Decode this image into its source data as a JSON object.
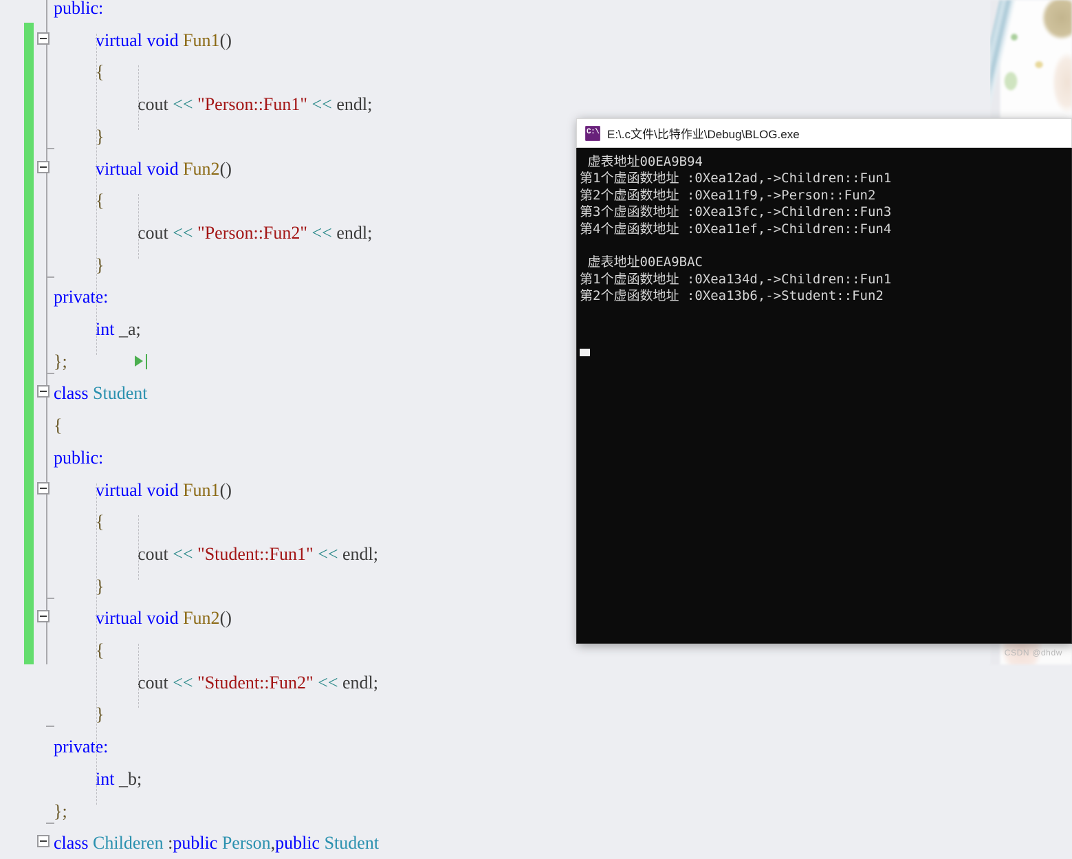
{
  "editor": {
    "language": "cpp",
    "background": "#edeef2",
    "change_bar_color": "#64dd6e",
    "colors": {
      "keyword": "#0000ff",
      "type": "#2b91af",
      "function": "#8b6914",
      "string": "#a31515",
      "operator": "#2e8b8b",
      "plain": "#3b3b3b"
    },
    "run_to_cursor_icon": "play-triangle-icon",
    "lines": [
      {
        "indent": 0,
        "tokens": [
          {
            "t": "public:",
            "c": "kw"
          }
        ]
      },
      {
        "indent": 1,
        "tokens": [
          {
            "t": "virtual void ",
            "c": "kw"
          },
          {
            "t": "Fun1",
            "c": "fn"
          },
          {
            "t": "()",
            "c": "plain"
          }
        ]
      },
      {
        "indent": 1,
        "tokens": [
          {
            "t": "{",
            "c": "brace"
          }
        ]
      },
      {
        "indent": 2,
        "tokens": [
          {
            "t": "cout ",
            "c": "plain"
          },
          {
            "t": "<<",
            "c": "op"
          },
          {
            "t": " ",
            "c": "plain"
          },
          {
            "t": "\"Person::Fun1\"",
            "c": "str"
          },
          {
            "t": " ",
            "c": "plain"
          },
          {
            "t": "<<",
            "c": "op"
          },
          {
            "t": " endl;",
            "c": "plain"
          }
        ]
      },
      {
        "indent": 1,
        "tokens": [
          {
            "t": "}",
            "c": "brace"
          }
        ]
      },
      {
        "indent": 1,
        "tokens": [
          {
            "t": "virtual void ",
            "c": "kw"
          },
          {
            "t": "Fun2",
            "c": "fn"
          },
          {
            "t": "()",
            "c": "plain"
          }
        ]
      },
      {
        "indent": 1,
        "tokens": [
          {
            "t": "{",
            "c": "brace"
          }
        ]
      },
      {
        "indent": 2,
        "tokens": [
          {
            "t": "cout ",
            "c": "plain"
          },
          {
            "t": "<<",
            "c": "op"
          },
          {
            "t": " ",
            "c": "plain"
          },
          {
            "t": "\"Person::Fun2\"",
            "c": "str"
          },
          {
            "t": " ",
            "c": "plain"
          },
          {
            "t": "<<",
            "c": "op"
          },
          {
            "t": " endl;",
            "c": "plain"
          }
        ]
      },
      {
        "indent": 1,
        "tokens": [
          {
            "t": "}",
            "c": "brace"
          }
        ]
      },
      {
        "indent": 0,
        "tokens": [
          {
            "t": "private:",
            "c": "kw"
          }
        ]
      },
      {
        "indent": 1,
        "tokens": [
          {
            "t": "int",
            "c": "kw"
          },
          {
            "t": " _a;",
            "c": "plain"
          }
        ]
      },
      {
        "indent": 0,
        "tokens": [
          {
            "t": "};",
            "c": "brace"
          }
        ]
      },
      {
        "indent": 0,
        "tokens": [
          {
            "t": "class ",
            "c": "kw"
          },
          {
            "t": "Student",
            "c": "type"
          }
        ]
      },
      {
        "indent": 0,
        "tokens": [
          {
            "t": "{",
            "c": "brace"
          }
        ]
      },
      {
        "indent": 0,
        "tokens": [
          {
            "t": "public:",
            "c": "kw"
          }
        ]
      },
      {
        "indent": 1,
        "tokens": [
          {
            "t": "virtual void ",
            "c": "kw"
          },
          {
            "t": "Fun1",
            "c": "fn"
          },
          {
            "t": "()",
            "c": "plain"
          }
        ]
      },
      {
        "indent": 1,
        "tokens": [
          {
            "t": "{",
            "c": "brace"
          }
        ]
      },
      {
        "indent": 2,
        "tokens": [
          {
            "t": "cout ",
            "c": "plain"
          },
          {
            "t": "<<",
            "c": "op"
          },
          {
            "t": " ",
            "c": "plain"
          },
          {
            "t": "\"Student::Fun1\"",
            "c": "str"
          },
          {
            "t": " ",
            "c": "plain"
          },
          {
            "t": "<<",
            "c": "op"
          },
          {
            "t": " endl;",
            "c": "plain"
          }
        ]
      },
      {
        "indent": 1,
        "tokens": [
          {
            "t": "}",
            "c": "brace"
          }
        ]
      },
      {
        "indent": 1,
        "tokens": [
          {
            "t": "virtual void ",
            "c": "kw"
          },
          {
            "t": "Fun2",
            "c": "fn"
          },
          {
            "t": "()",
            "c": "plain"
          }
        ]
      },
      {
        "indent": 1,
        "tokens": [
          {
            "t": "{",
            "c": "brace"
          }
        ]
      },
      {
        "indent": 2,
        "tokens": [
          {
            "t": "cout ",
            "c": "plain"
          },
          {
            "t": "<<",
            "c": "op"
          },
          {
            "t": " ",
            "c": "plain"
          },
          {
            "t": "\"Student::Fun2\"",
            "c": "str"
          },
          {
            "t": " ",
            "c": "plain"
          },
          {
            "t": "<<",
            "c": "op"
          },
          {
            "t": " endl;",
            "c": "plain"
          }
        ]
      },
      {
        "indent": 1,
        "tokens": [
          {
            "t": "}",
            "c": "brace"
          }
        ]
      },
      {
        "indent": 0,
        "tokens": [
          {
            "t": "private:",
            "c": "kw"
          }
        ]
      },
      {
        "indent": 1,
        "tokens": [
          {
            "t": "int",
            "c": "kw"
          },
          {
            "t": " _b;",
            "c": "plain"
          }
        ]
      },
      {
        "indent": 0,
        "tokens": [
          {
            "t": "};",
            "c": "brace"
          }
        ]
      },
      {
        "indent": 0,
        "tokens": [
          {
            "t": "class ",
            "c": "kw"
          },
          {
            "t": "Childeren",
            "c": "type"
          },
          {
            "t": " :",
            "c": "plain"
          },
          {
            "t": "public ",
            "c": "kw"
          },
          {
            "t": "Person",
            "c": "type"
          },
          {
            "t": ",",
            "c": "plain"
          },
          {
            "t": "public ",
            "c": "kw"
          },
          {
            "t": "Student",
            "c": "type"
          }
        ]
      }
    ]
  },
  "console": {
    "icon": "console-app-icon",
    "title": "E:\\.c文件\\比特作业\\Debug\\BLOG.exe",
    "background": "#0c0c0c",
    "foreground": "#d6d6d6",
    "output": " 虚表地址00EA9B94\n第1个虚函数地址 :0Xea12ad,->Children::Fun1\n第2个虚函数地址 :0Xea11f9,->Person::Fun2\n第3个虚函数地址 :0Xea13fc,->Children::Fun3\n第4个虚函数地址 :0Xea11ef,->Children::Fun4\n\n 虚表地址00EA9BAC\n第1个虚函数地址 :0Xea134d,->Children::Fun1\n第2个虚函数地址 :0Xea13b6,->Student::Fun2",
    "output_lines": [
      " 虚表地址00EA9B94",
      "第1个虚函数地址 :0Xea12ad,->Children::Fun1",
      "第2个虚函数地址 :0Xea11f9,->Person::Fun2",
      "第3个虚函数地址 :0Xea13fc,->Children::Fun3",
      "第4个虚函数地址 :0Xea11ef,->Children::Fun4",
      "",
      " 虚表地址00EA9BAC",
      "第1个虚函数地址 :0Xea134d,->Children::Fun1",
      "第2个虚函数地址 :0Xea13b6,->Student::Fun2"
    ]
  },
  "watermark": {
    "text": "CSDN @dhdw"
  }
}
